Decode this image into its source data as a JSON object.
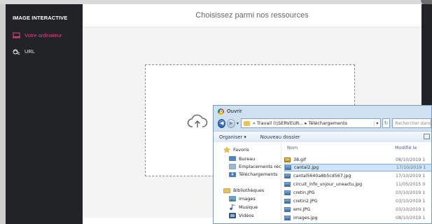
{
  "sidebar": {
    "title": "IMAGE INTERACTIVE",
    "items": [
      {
        "label": "Votre ordinateur",
        "icon": "monitor-icon"
      },
      {
        "label": "URL",
        "icon": "link-icon"
      }
    ]
  },
  "main": {
    "header": "Choisissez parmi nos ressources"
  },
  "colors": {
    "accent": "#e0448a",
    "sidebar_bg": "#222326"
  },
  "dialog": {
    "title": "Ouvrir",
    "address_path": "« Travail (\\\\SERVEUR... ▸ Téléchargements",
    "search_placeholder": "Rechercher dans : T",
    "toolbar": {
      "organize": "Organiser ▾",
      "new_folder": "Nouveau dossier"
    },
    "nav": [
      {
        "label": "Favoris",
        "icon": "star-icon"
      },
      {
        "label": "Bureau",
        "icon": "desktop-icon"
      },
      {
        "label": "Emplacements récents",
        "icon": "recent-places-icon"
      },
      {
        "label": "Téléchargements",
        "icon": "download-folder-icon"
      },
      {
        "label": "Bibliothèques",
        "icon": "libraries-icon"
      },
      {
        "label": "Images",
        "icon": "pictures-icon"
      },
      {
        "label": "Musique",
        "icon": "music-icon"
      },
      {
        "label": "Vidéos",
        "icon": "videos-icon"
      }
    ],
    "columns": {
      "name": "Nom",
      "modified": "Modifié le"
    },
    "files": [
      {
        "name": "38.gif",
        "date": "08/10/2019 1"
      },
      {
        "name": "cantal2.jpg",
        "date": "17/10/2019 1"
      },
      {
        "name": "cantal5640a8b5cd567.jpg",
        "date": "17/10/2019 1"
      },
      {
        "name": "circuit_info_unjour_uneactu.jpg",
        "date": "11/05/2015 0"
      },
      {
        "name": "cretin.JPG",
        "date": "03/10/2019 1"
      },
      {
        "name": "cretin2.JPG",
        "date": "03/10/2019 1"
      },
      {
        "name": "emi.JPG",
        "date": "03/10/2019 1"
      },
      {
        "name": "images.jpg",
        "date": "08/10/2019 1"
      }
    ]
  }
}
